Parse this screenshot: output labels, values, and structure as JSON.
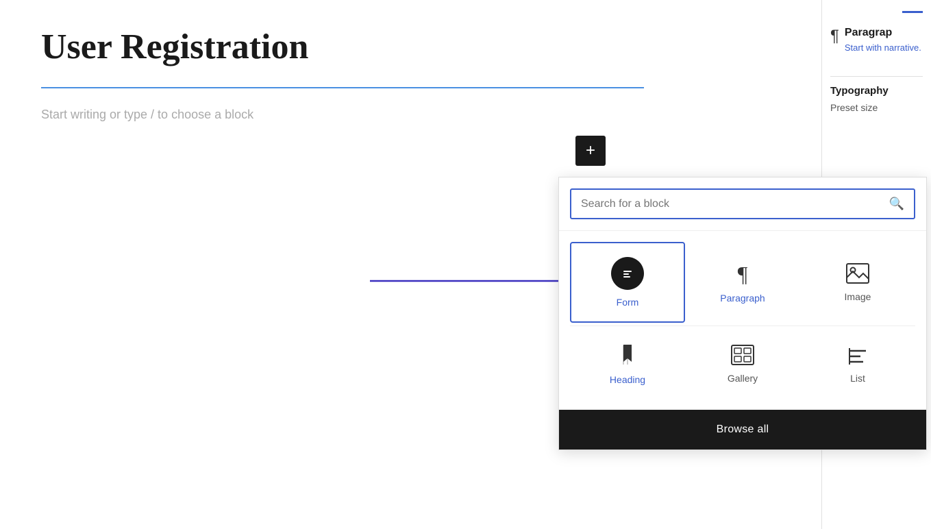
{
  "page": {
    "title": "User Registration",
    "placeholder": "Start writing or type / to choose a block",
    "divider_color": "#4a90e2"
  },
  "add_button": {
    "label": "+"
  },
  "block_inserter": {
    "search_placeholder": "Search for a block",
    "blocks_row1": [
      {
        "id": "form",
        "label": "Form",
        "icon_type": "form",
        "selected": true,
        "label_color": "blue"
      },
      {
        "id": "paragraph",
        "label": "Paragraph",
        "icon_type": "pilcrow",
        "selected": false,
        "label_color": "blue"
      },
      {
        "id": "image",
        "label": "Image",
        "icon_type": "image",
        "selected": false,
        "label_color": "dark"
      }
    ],
    "blocks_row2": [
      {
        "id": "heading",
        "label": "Heading",
        "icon_type": "bookmark",
        "selected": false,
        "label_color": "blue"
      },
      {
        "id": "gallery",
        "label": "Gallery",
        "icon_type": "gallery",
        "selected": false,
        "label_color": "dark"
      },
      {
        "id": "list",
        "label": "List",
        "icon_type": "list",
        "selected": false,
        "label_color": "dark"
      }
    ],
    "browse_all_label": "Browse all"
  },
  "right_panel": {
    "block_name": "Paragrap",
    "block_desc": "Start with narrative.",
    "section_title": "Typography",
    "preset_label": "Preset size"
  }
}
